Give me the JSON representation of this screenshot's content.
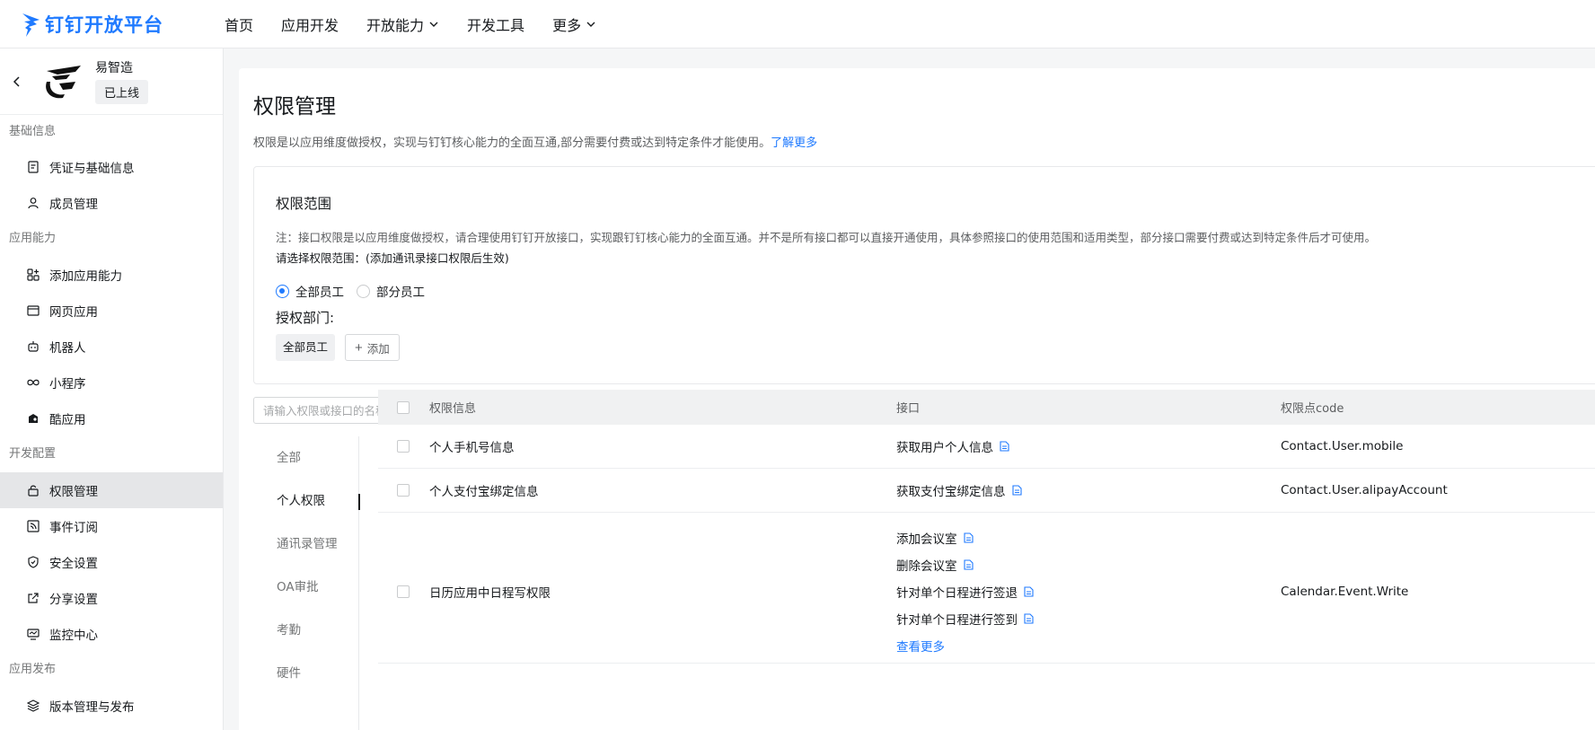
{
  "topnav": {
    "logo_text": "钉钉开放平台",
    "items": [
      {
        "label": "首页"
      },
      {
        "label": "应用开发"
      },
      {
        "label": "开放能力"
      },
      {
        "label": "开发工具"
      },
      {
        "label": "更多"
      }
    ]
  },
  "sidebar": {
    "app_name": "易智造",
    "app_status": "已上线",
    "groups": [
      {
        "title": "基础信息",
        "items": [
          "凭证与基础信息",
          "成员管理"
        ]
      },
      {
        "title": "应用能力",
        "items": [
          "添加应用能力",
          "网页应用",
          "机器人",
          "小程序",
          "酷应用"
        ]
      },
      {
        "title": "开发配置",
        "items": [
          "权限管理",
          "事件订阅",
          "安全设置",
          "分享设置",
          "监控中心"
        ]
      },
      {
        "title": "应用发布",
        "items": [
          "版本管理与发布"
        ]
      }
    ]
  },
  "main": {
    "title": "权限管理",
    "desc": "权限是以应用维度做授权，实现与钉钉核心能力的全面互通,部分需要付费或达到特定条件才能使用。",
    "learn_more": "了解更多",
    "scope": {
      "title": "权限范围",
      "note": "注：接口权限是以应用维度做授权，请合理使用钉钉开放接口，实现跟钉钉核心能力的全面互通。并不是所有接口都可以直接开通使用，具体参照接口的使用范围和适用类型，部分接口需要付费或达到特定条件后才可使用。",
      "choose": "请选择权限范围：(添加通讯录接口权限后生效)",
      "radio_all": "全部员工",
      "radio_part": "部分员工",
      "dept_label": "授权部门:",
      "dept_tag": "全部员工",
      "add_label": "添加"
    },
    "search_placeholder": "请输入权限或接口的名称进行搜索",
    "categories": [
      "全部",
      "个人权限",
      "通讯录管理",
      "OA审批",
      "考勤",
      "硬件"
    ],
    "table": {
      "headers": {
        "info": "权限信息",
        "api": "接口",
        "code": "权限点code"
      },
      "rows": [
        {
          "info": "个人手机号信息",
          "apis": [
            "获取用户个人信息"
          ],
          "code": "Contact.User.mobile"
        },
        {
          "info": "个人支付宝绑定信息",
          "apis": [
            "获取支付宝绑定信息"
          ],
          "code": "Contact.User.alipayAccount"
        },
        {
          "info": "日历应用中日程写权限",
          "apis": [
            "添加会议室",
            "删除会议室",
            "针对单个日程进行签退",
            "针对单个日程进行签到"
          ],
          "code": "Calendar.Event.Write",
          "more": "查看更多"
        }
      ]
    }
  },
  "colors": {
    "accent": "#1f7aff",
    "active_bg": "#e5e6e8"
  }
}
